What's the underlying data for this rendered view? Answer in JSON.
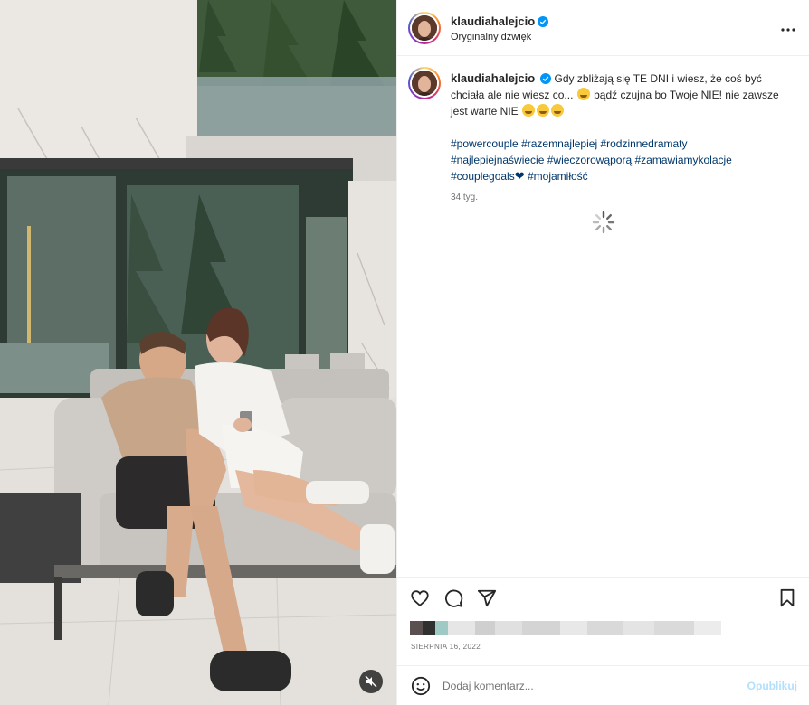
{
  "post": {
    "username": "klaudiahalejcio",
    "audio_label": "Oryginalny dźwięk",
    "caption_line1": "Gdy zbliżają się TE DNI i wiesz, że coś być chciała ale nie wiesz co...",
    "caption_line2": "bądź czujna bo Twoje NIE! nie zawsze jest warte NIE",
    "hashtags": [
      "#powercouple",
      "#razemnajlepiej",
      "#rodzinnedramaty",
      "#najlepiejnaświecie",
      "#wieczorowąporą",
      "#zamawiamykolacje",
      "#couplegoals",
      "#mojamiłość"
    ],
    "time_ago": "34 tyg.",
    "date": "SIERPNIA 16, 2022"
  },
  "comment": {
    "placeholder": "Dodaj komentarz...",
    "post_label": "Opublikuj"
  },
  "icons": {
    "verified": "verified-badge-icon",
    "more": "more-options-icon",
    "like": "heart-icon",
    "comment": "comment-icon",
    "share": "share-icon",
    "save": "bookmark-icon",
    "emoji": "emoji-icon",
    "mute": "muted-audio-icon",
    "loading": "loading-spinner-icon"
  },
  "colors": {
    "accent_link": "#00376b",
    "post_button_disabled": "#b2dffc",
    "verified_blue": "#0095f6",
    "heart_red": "#e0245e"
  }
}
